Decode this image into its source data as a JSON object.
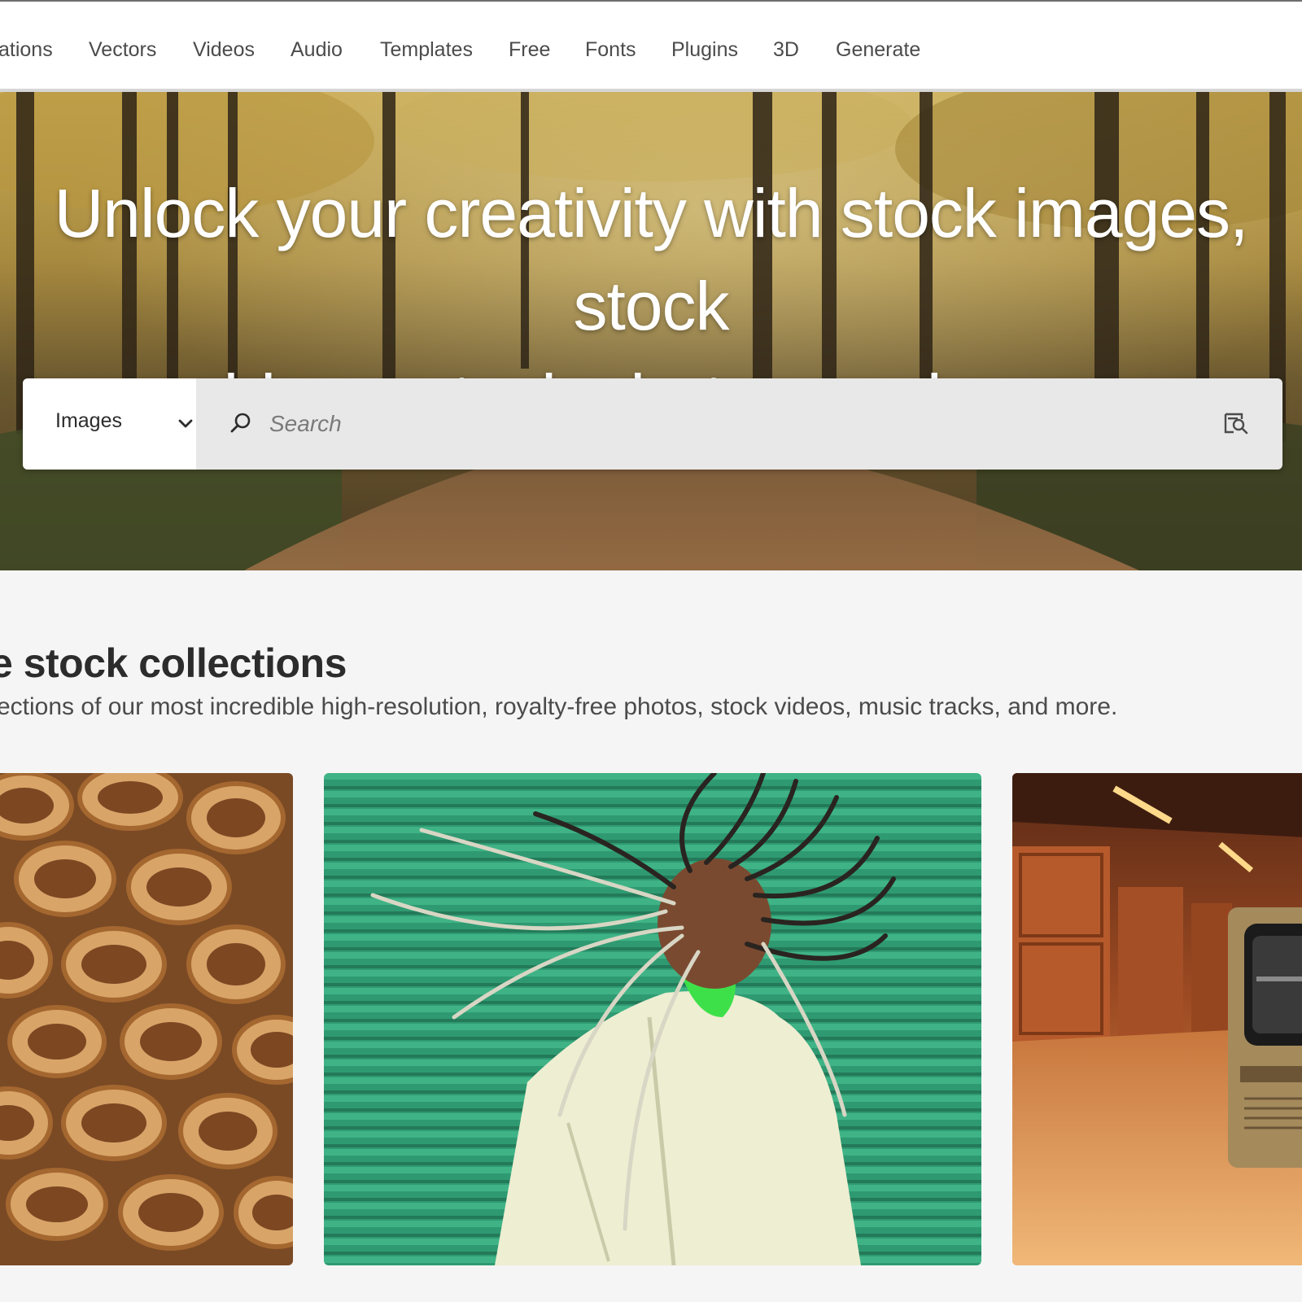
{
  "nav": {
    "items": [
      {
        "label": "ations"
      },
      {
        "label": "Vectors"
      },
      {
        "label": "Videos"
      },
      {
        "label": "Audio"
      },
      {
        "label": "Templates"
      },
      {
        "label": "Free"
      },
      {
        "label": "Fonts"
      },
      {
        "label": "Plugins"
      },
      {
        "label": "3D"
      },
      {
        "label": "Generate"
      }
    ]
  },
  "hero": {
    "title_line1": "Unlock your creativity with stock images, stock",
    "title_line2": "videos, stock photos, and more"
  },
  "search": {
    "type_selected": "Images",
    "placeholder": "Search",
    "value": ""
  },
  "collections": {
    "title": "e stock collections",
    "subtitle": "ections of our most incredible high-resolution, royalty-free photos, stock videos, music tracks, and more."
  },
  "icons": {
    "dropdown": "chevron-down-icon",
    "search": "search-icon",
    "visual_search": "visual-search-icon"
  },
  "colors": {
    "nav_bg": "#ffffff",
    "search_type_bg": "#ffffff",
    "search_field_bg": "#e8e8e8",
    "page_bg": "#f5f5f5",
    "hero_text": "#ffffff"
  }
}
